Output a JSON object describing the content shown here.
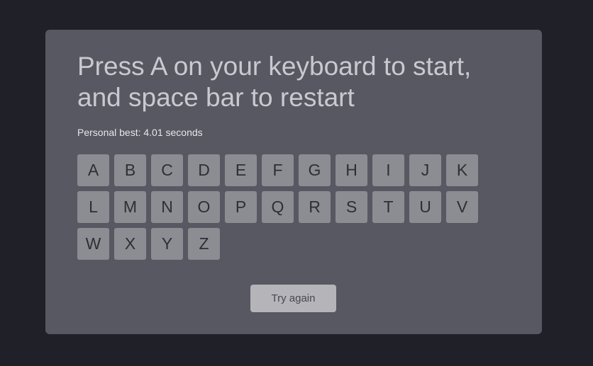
{
  "game": {
    "title": "Press A on your keyboard to start, and space bar to restart",
    "personal_best": "Personal best: 4.01 seconds",
    "keys": [
      "A",
      "B",
      "C",
      "D",
      "E",
      "F",
      "G",
      "H",
      "I",
      "J",
      "K",
      "L",
      "M",
      "N",
      "O",
      "P",
      "Q",
      "R",
      "S",
      "T",
      "U",
      "V",
      "W",
      "X",
      "Y",
      "Z"
    ],
    "retry_label": "Try again"
  }
}
